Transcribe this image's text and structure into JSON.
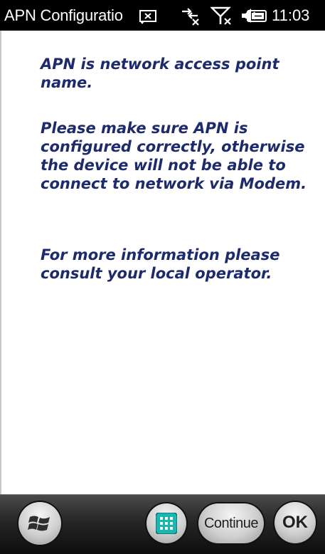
{
  "titlebar": {
    "title": "APN Configuratio",
    "time": "11:03",
    "icons": [
      "message-notification-icon",
      "data-connection-icon",
      "no-signal-icon",
      "volume-icon",
      "battery-icon"
    ]
  },
  "message": {
    "paragraph1": "APN is network access point name.",
    "paragraph2": "Please make sure APN is configured correctly, otherwise the device will not be able to connect to network via Modem.",
    "paragraph3": "For more information please consult your local operator.",
    "text_color": "#1d2a6b"
  },
  "softkeys": {
    "start_icon": "windows-start-icon",
    "keyboard_icon": "keyboard-icon",
    "continue_label": "Continue",
    "ok_label": "OK"
  }
}
